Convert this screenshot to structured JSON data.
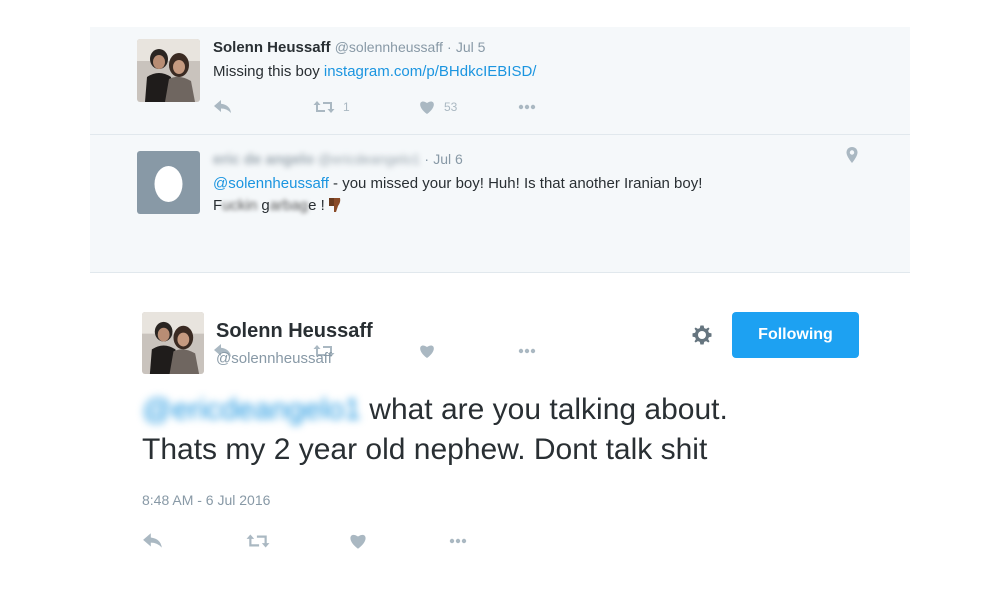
{
  "thread": {
    "tweet1": {
      "name": "Solenn Heussaff",
      "handle": "@solennheussaff",
      "separator": "·",
      "date": "Jul 5",
      "text": "Missing this boy ",
      "link": "instagram.com/p/BHdkcIEBISD/",
      "retweets": "1",
      "likes": "53"
    },
    "tweet2": {
      "name": "eric de angelo",
      "handle": "@ericdeangelo1",
      "separator": "·",
      "date": "Jul 6",
      "mention": "@solennheussaff",
      "text_line1": " - you missed your boy! Huh! Is that another Iranian boy!",
      "line2_a": "F",
      "line2_b": "uckin",
      "line2_c": " g",
      "line2_d": "arbag",
      "line2_e": "e !"
    }
  },
  "main": {
    "name": "Solenn Heussaff",
    "handle": "@solennheussaff",
    "follow_label": "Following",
    "blurred_mention": "@ericdeangelo1",
    "text_part1": " what are you talking about.",
    "text_part2": "Thats my 2 year old nephew. Dont talk shit",
    "timestamp": "8:48 AM - 6 Jul 2016"
  },
  "icons": {
    "reply": "reply-icon",
    "retweet": "retweet-icon",
    "like": "heart-icon",
    "more": "more-dots-icon",
    "location": "location-pin-icon",
    "settings": "gear-icon"
  },
  "colors": {
    "link": "#1b95e0",
    "button": "#1da1f2",
    "muted": "#8899a6",
    "thread_bg": "#f5f8fa"
  }
}
